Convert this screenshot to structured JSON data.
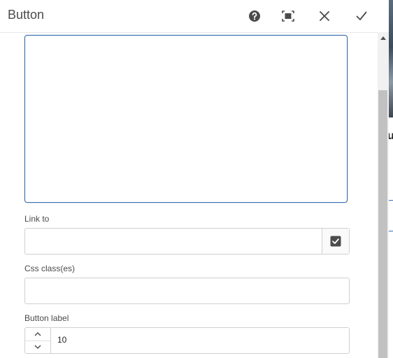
{
  "dialog": {
    "title": "Button",
    "actions": {
      "help": "help-icon",
      "fullscreen": "fullscreen-icon",
      "cancel": "close-icon",
      "confirm": "check-icon"
    }
  },
  "form": {
    "text_area_value": "",
    "link_to": {
      "label": "Link to",
      "value": ""
    },
    "css_classes": {
      "label": "Css class(es)",
      "value": ""
    },
    "button_label": {
      "label": "Button label",
      "value": "10"
    }
  },
  "background": {
    "partial_text": "u"
  },
  "colors": {
    "accent": "#3a6fb0",
    "border": "#d0d0d0",
    "text": "#4b4b4b"
  }
}
